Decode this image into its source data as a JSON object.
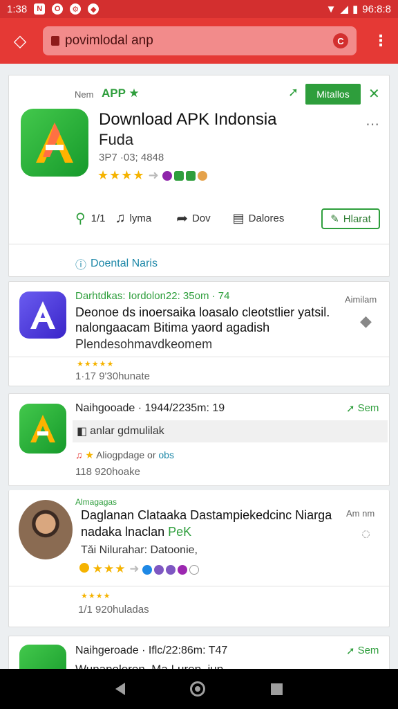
{
  "status_bar": {
    "time": "1:38",
    "battery": "96:8:8"
  },
  "browser": {
    "url": "povimlodal anp"
  },
  "app_card": {
    "meta_prefix": "Nem",
    "app_label": "APP ★",
    "install_button": "Mitallos",
    "title_line1": "Download APK Indonsia",
    "title_line2": "Fuda",
    "meta_line": "3P7 ·03; 4848",
    "rating_stars": "★★★★",
    "stat_1": "1/1",
    "stat_2": "lyma",
    "stat_3": "Dov",
    "stat_4": "Dalores",
    "action_button": "Hlarat",
    "download_link": "Doental Naris"
  },
  "posts": [
    {
      "header": "Darhtdkas: Iordolon22: 35om · 74",
      "side_label": "Aimilam",
      "body_line1": "Deonoe ds inoersaika loasalo cleotstlier yatsil.",
      "body_line2": "nalongaacam Bitima yaord agadish",
      "body_line3": "Plendesohmavdkeomem",
      "mini_stars": "★★★★★",
      "footer": "1·17 9'30hunate"
    },
    {
      "header": "Naihgooade · 1944/2235m: 19",
      "send_label": "Sem",
      "quote": "anlar gdmulilak",
      "row_text": "Aliogpdage or",
      "row_link": "obs",
      "footer": "118 920hoake"
    },
    {
      "tag": "Almagagas",
      "side_label": "Am nm",
      "body_line1": "Daglanan Clataaka Dastampiekedcinc Niarga",
      "body_line2": "nadaka lnaclan",
      "body_highlight": "PeK",
      "body_line3": "Tǎi Nilurahar: Datoonie,",
      "rating_stars": "★★★",
      "mini_stars": "★★★★",
      "footer": "1/1 920huladas"
    },
    {
      "header": "Naihgeroade · Iflc/22:86m: T47",
      "send_label": "Sem",
      "body_line1": "Wunanoleren. Ma Lurep. iup"
    }
  ]
}
